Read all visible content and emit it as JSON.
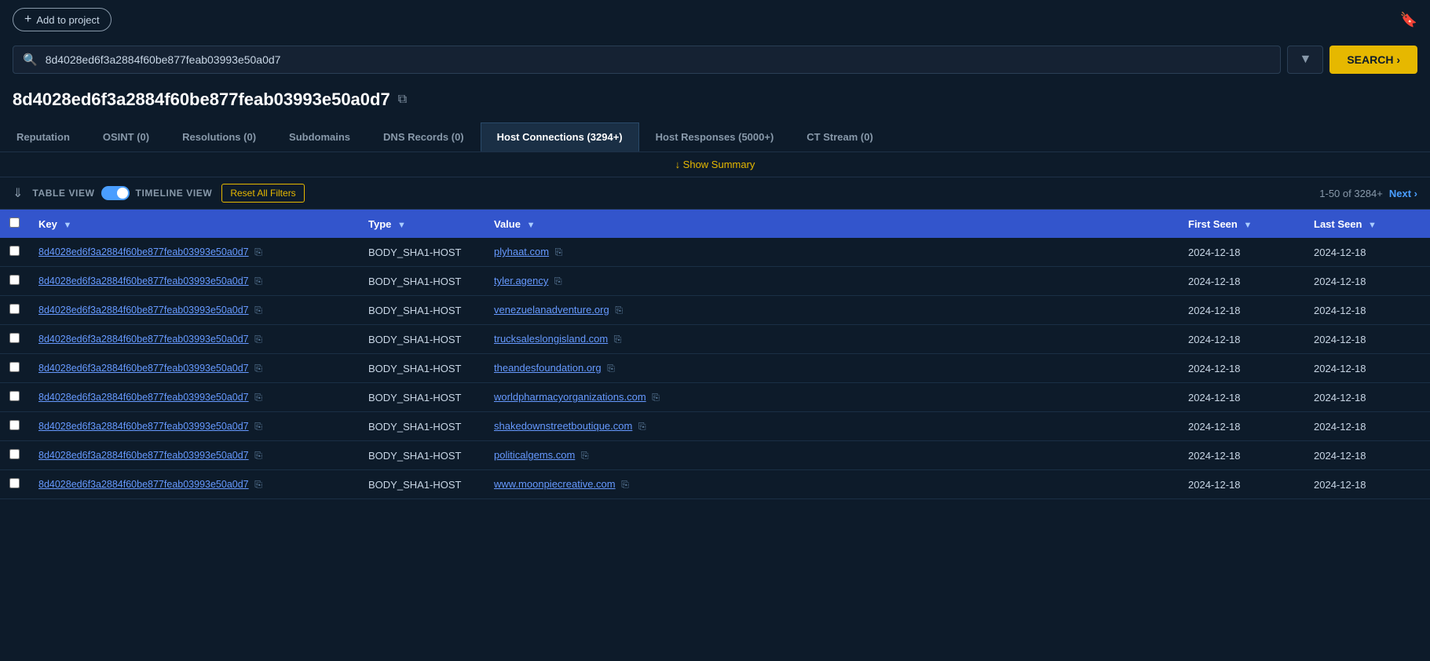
{
  "topbar": {
    "add_project_label": "Add to project",
    "bookmark_char": "🔖"
  },
  "search": {
    "query": "8d4028ed6f3a2884f60be877feab03993e50a0d7",
    "placeholder": "8d4028ed6f3a2884f60be877feab03993e50a0d7",
    "button_label": "SEARCH ›",
    "filter_char": "▼"
  },
  "page_title": "8d4028ed6f3a2884f60be877feab03993e50a0d7",
  "copy_icon": "⧉",
  "tabs": [
    {
      "label": "Reputation",
      "count": null,
      "active": false
    },
    {
      "label": "OSINT (0)",
      "count": 0,
      "active": false
    },
    {
      "label": "Resolutions (0)",
      "count": 0,
      "active": false
    },
    {
      "label": "Subdomains",
      "count": null,
      "active": false
    },
    {
      "label": "DNS Records (0)",
      "count": 0,
      "active": false
    },
    {
      "label": "Host Connections (3294+)",
      "count": "3294+",
      "active": true
    },
    {
      "label": "Host Responses (5000+)",
      "count": "5000+",
      "active": false
    },
    {
      "label": "CT Stream (0)",
      "count": 0,
      "active": false
    }
  ],
  "show_summary_label": "↓ Show Summary",
  "toolbar": {
    "table_view_label": "TABLE VIEW",
    "timeline_view_label": "TIMELINE VIEW",
    "reset_filters_label": "Reset All Filters",
    "pagination": "1-50 of 3284+",
    "next_label": "Next ›"
  },
  "table": {
    "headers": [
      {
        "label": "Key",
        "has_filter": true
      },
      {
        "label": "Type",
        "has_filter": true
      },
      {
        "label": "Value",
        "has_filter": true
      },
      {
        "label": "First Seen",
        "has_filter": true
      },
      {
        "label": "Last Seen",
        "has_filter": true
      }
    ],
    "rows": [
      {
        "key": "8d4028ed6f3a2884f60be877feab03993e50a0d7",
        "type": "BODY_SHA1-HOST",
        "value": "plyhaat.com",
        "first_seen": "2024-12-18",
        "last_seen": "2024-12-18"
      },
      {
        "key": "8d4028ed6f3a2884f60be877feab03993e50a0d7",
        "type": "BODY_SHA1-HOST",
        "value": "tyler.agency",
        "first_seen": "2024-12-18",
        "last_seen": "2024-12-18"
      },
      {
        "key": "8d4028ed6f3a2884f60be877feab03993e50a0d7",
        "type": "BODY_SHA1-HOST",
        "value": "venezuelanadventure.org",
        "first_seen": "2024-12-18",
        "last_seen": "2024-12-18"
      },
      {
        "key": "8d4028ed6f3a2884f60be877feab03993e50a0d7",
        "type": "BODY_SHA1-HOST",
        "value": "trucksaleslongisland.com",
        "first_seen": "2024-12-18",
        "last_seen": "2024-12-18"
      },
      {
        "key": "8d4028ed6f3a2884f60be877feab03993e50a0d7",
        "type": "BODY_SHA1-HOST",
        "value": "theandesfoundation.org",
        "first_seen": "2024-12-18",
        "last_seen": "2024-12-18"
      },
      {
        "key": "8d4028ed6f3a2884f60be877feab03993e50a0d7",
        "type": "BODY_SHA1-HOST",
        "value": "worldpharmacyorganizations.com",
        "first_seen": "2024-12-18",
        "last_seen": "2024-12-18"
      },
      {
        "key": "8d4028ed6f3a2884f60be877feab03993e50a0d7",
        "type": "BODY_SHA1-HOST",
        "value": "shakedownstreetboutique.com",
        "first_seen": "2024-12-18",
        "last_seen": "2024-12-18"
      },
      {
        "key": "8d4028ed6f3a2884f60be877feab03993e50a0d7",
        "type": "BODY_SHA1-HOST",
        "value": "politicalgems.com",
        "first_seen": "2024-12-18",
        "last_seen": "2024-12-18"
      },
      {
        "key": "8d4028ed6f3a2884f60be877feab03993e50a0d7",
        "type": "BODY_SHA1-HOST",
        "value": "www.moonpiecreative.com",
        "first_seen": "2024-12-18",
        "last_seen": "2024-12-18"
      }
    ]
  }
}
